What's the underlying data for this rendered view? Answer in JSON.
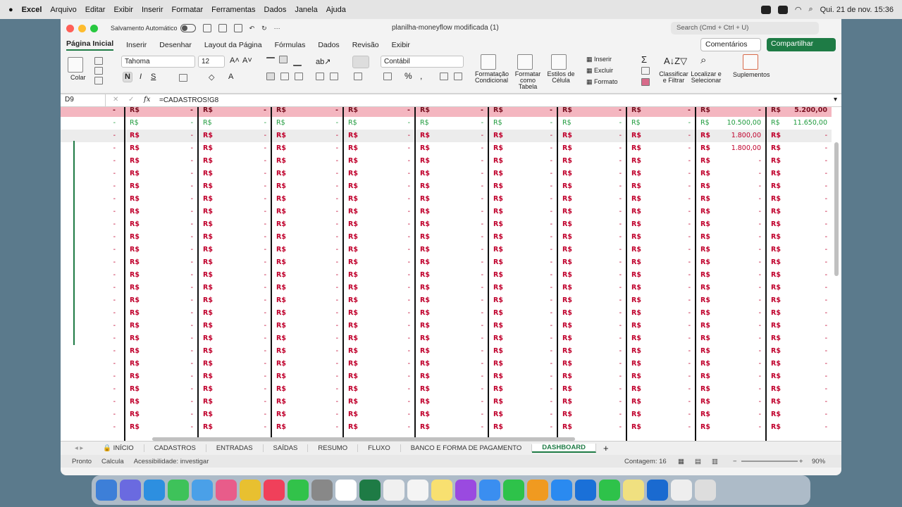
{
  "menubar": {
    "app": "Excel",
    "items": [
      "Arquivo",
      "Editar",
      "Exibir",
      "Inserir",
      "Formatar",
      "Ferramentas",
      "Dados",
      "Janela",
      "Ajuda"
    ],
    "datetime": "Qui. 21 de nov.  15:36"
  },
  "titlebar": {
    "autosave": "Salvamento Automático",
    "doc": "planilha-moneyflow modificada (1)",
    "search": "Search (Cmd + Ctrl + U)"
  },
  "tabs": [
    "Página Inicial",
    "Inserir",
    "Desenhar",
    "Layout da Página",
    "Fórmulas",
    "Dados",
    "Revisão",
    "Exibir"
  ],
  "comments": "Comentários",
  "share": "Compartilhar",
  "ribbon": {
    "paste": "Colar",
    "font": "Tahoma",
    "size": "12",
    "bold": "N",
    "italic": "I",
    "underline": "S",
    "numfmt": "Contábil",
    "cond": "Formatação Condicional",
    "fmt_table": "Formatar como Tabela",
    "cell_styles": "Estilos de Célula",
    "insert": "Inserir",
    "delete": "Excluir",
    "format": "Formato",
    "sort": "Classificar e Filtrar",
    "find": "Localizar e Selecionar",
    "addins": "Suplementos"
  },
  "formula": {
    "name": "D9",
    "fx": "fx",
    "text": "=CADASTROS!G8"
  },
  "cols": {
    "currency": "R$",
    "dash": "-"
  },
  "special": {
    "r0_last": "5.200,00",
    "r1_a": "10.500,00",
    "r1_b": "11.650,00",
    "r2_a": "1.800,00",
    "r3_a": "1.800,00"
  },
  "sheets": [
    "INÍCIO",
    "CADASTROS",
    "ENTRADAS",
    "SAÍDAS",
    "RESUMO",
    "FLUXO",
    "BANCO E FORMA DE PAGAMENTO",
    "DASHBOARD"
  ],
  "status": {
    "ready": "Pronto",
    "calc": "Calcula",
    "access": "Acessibilidade: investigar",
    "count": "Contagem: 16",
    "zoom": "90%"
  }
}
